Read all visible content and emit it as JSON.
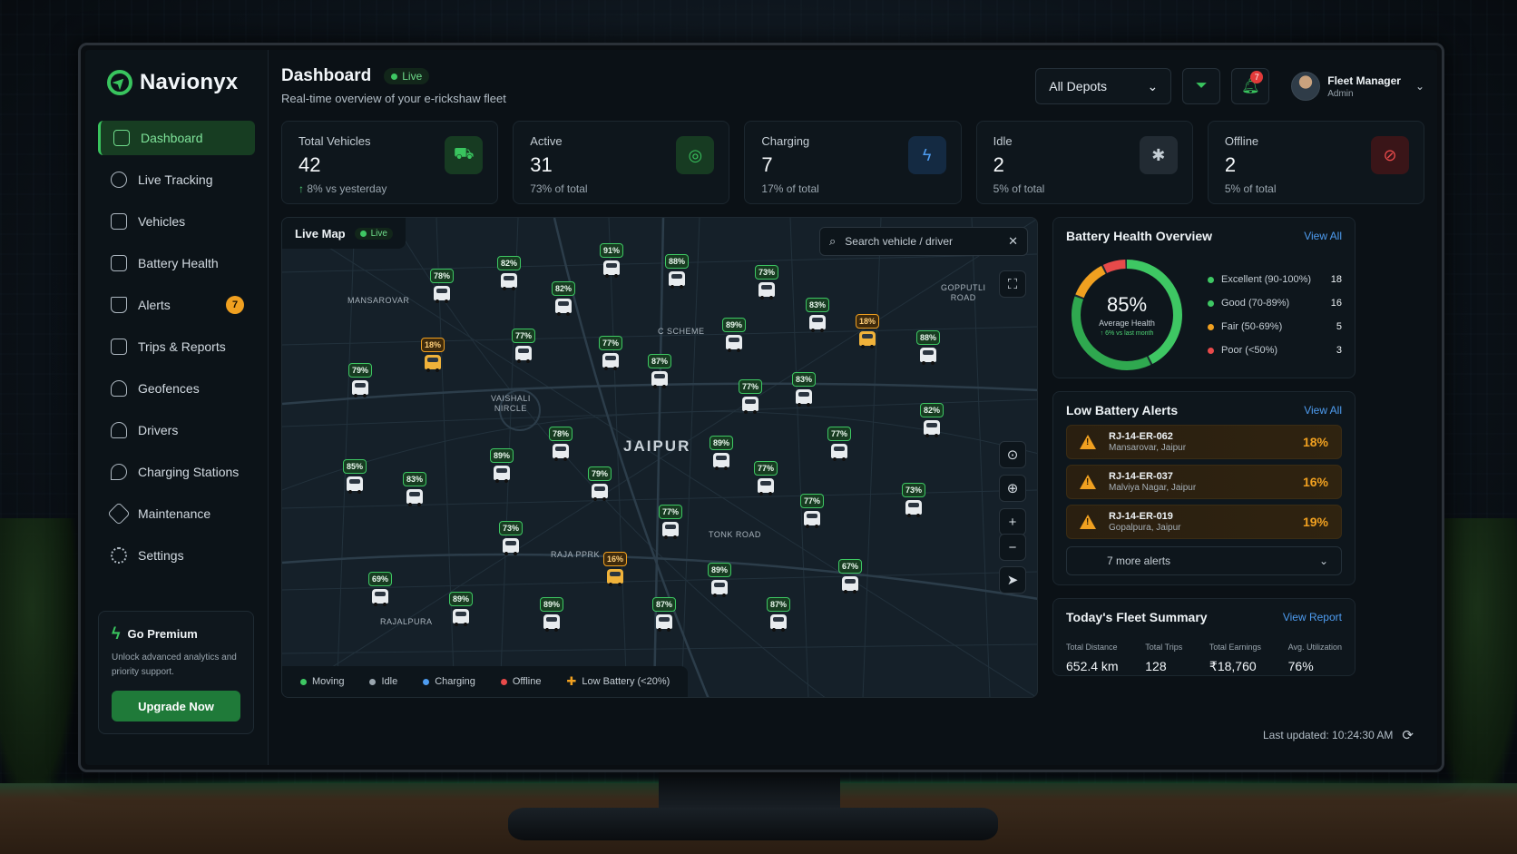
{
  "brand": {
    "name": "Navionyx"
  },
  "sidebar": {
    "items": [
      {
        "label": "Dashboard",
        "icon": "dashboard-icon",
        "active": true
      },
      {
        "label": "Live Tracking",
        "icon": "location-icon"
      },
      {
        "label": "Vehicles",
        "icon": "vehicle-icon"
      },
      {
        "label": "Battery Health",
        "icon": "battery-icon"
      },
      {
        "label": "Alerts",
        "icon": "alert-icon",
        "badge": "7"
      },
      {
        "label": "Trips & Reports",
        "icon": "report-icon"
      },
      {
        "label": "Geofences",
        "icon": "geofence-icon"
      },
      {
        "label": "Drivers",
        "icon": "driver-icon"
      },
      {
        "label": "Charging Stations",
        "icon": "charging-station-icon"
      },
      {
        "label": "Maintenance",
        "icon": "wrench-icon"
      },
      {
        "label": "Settings",
        "icon": "gear-icon"
      }
    ],
    "premium": {
      "title": "Go Premium",
      "text": "Unlock advanced analytics and priority support.",
      "button": "Upgrade Now"
    }
  },
  "header": {
    "title": "Dashboard",
    "live": "Live",
    "subtitle": "Real-time overview of your e-rickshaw fleet",
    "depot": "All Depots",
    "notifications": "7",
    "user_name": "Fleet Manager",
    "user_role": "Admin"
  },
  "stats": [
    {
      "label": "Total Vehicles",
      "value": "42",
      "sub_prefix": "↑",
      "sub": " 8% vs yesterday",
      "color": "#39c45e",
      "bg": "#173b22",
      "icon": "car-icon",
      "glyph": "⛟"
    },
    {
      "label": "Active",
      "value": "31",
      "sub": "73% of total",
      "color": "#39c45e",
      "bg": "#173b22",
      "icon": "steering-icon",
      "glyph": "◎"
    },
    {
      "label": "Charging",
      "value": "7",
      "sub": "17% of total",
      "color": "#4e9cf0",
      "bg": "#142a42",
      "icon": "charging-bolt-icon",
      "glyph": "ϟ"
    },
    {
      "label": "Idle",
      "value": "2",
      "sub": "5% of total",
      "color": "#c4cdd4",
      "bg": "#222b33",
      "icon": "idle-wheel-icon",
      "glyph": "✱"
    },
    {
      "label": "Offline",
      "value": "2",
      "sub": "5% of total",
      "color": "#e84a4a",
      "bg": "#3a1518",
      "icon": "offline-icon",
      "glyph": "⊘"
    }
  ],
  "map": {
    "title": "Live Map",
    "live": "Live",
    "search_placeholder": "Search vehicle / driver",
    "city": "JAIPUR",
    "areas": [
      {
        "text": "MANSAROVAR"
      },
      {
        "text": "C SCHEME"
      },
      {
        "text": "GOPPUTLI\nROAD"
      },
      {
        "text": "VAISHALI\nNIRCLE"
      },
      {
        "text": "TONK ROAD"
      },
      {
        "text": "RAJA PPRK"
      },
      {
        "text": "RAJALPURA"
      }
    ],
    "vehicles": [
      {
        "pct": "78%"
      },
      {
        "pct": "82%"
      },
      {
        "pct": "91%"
      },
      {
        "pct": "88%"
      },
      {
        "pct": "82%"
      },
      {
        "pct": "73%"
      },
      {
        "pct": "83%"
      },
      {
        "pct": "18%",
        "low": true
      },
      {
        "pct": "88%"
      },
      {
        "pct": "18%",
        "low": true
      },
      {
        "pct": "79%"
      },
      {
        "pct": "77%"
      },
      {
        "pct": "77%"
      },
      {
        "pct": "87%"
      },
      {
        "pct": "89%"
      },
      {
        "pct": "77%"
      },
      {
        "pct": "83%"
      },
      {
        "pct": "82%"
      },
      {
        "pct": "85%"
      },
      {
        "pct": "83%"
      },
      {
        "pct": "89%"
      },
      {
        "pct": "78%"
      },
      {
        "pct": "79%"
      },
      {
        "pct": "89%"
      },
      {
        "pct": "77%"
      },
      {
        "pct": "77%"
      },
      {
        "pct": "77%"
      },
      {
        "pct": "73%"
      },
      {
        "pct": "73%"
      },
      {
        "pct": "77%"
      },
      {
        "pct": "16%",
        "low": true
      },
      {
        "pct": "89%"
      },
      {
        "pct": "67%"
      },
      {
        "pct": "69%"
      },
      {
        "pct": "89%"
      },
      {
        "pct": "89%"
      },
      {
        "pct": "87%"
      },
      {
        "pct": "87%"
      }
    ],
    "legend": [
      {
        "label": "Moving",
        "color": "#3ec763"
      },
      {
        "label": "Idle",
        "color": "#9aa6af"
      },
      {
        "label": "Charging",
        "color": "#4e9cf0"
      },
      {
        "label": "Offline",
        "color": "#e84a4a"
      },
      {
        "label": "Low Battery (<20%)",
        "color": "#f0a020",
        "plus": true
      }
    ]
  },
  "battery": {
    "title": "Battery Health Overview",
    "link": "View All",
    "value": "85%",
    "label": "Average Health",
    "sub": "↑ 6% vs last month",
    "rows": [
      {
        "name": "Excellent (90-100%)",
        "count": "18",
        "color": "#3ec763",
        "n": 18
      },
      {
        "name": "Good (70-89%)",
        "count": "16",
        "color": "#3ec763",
        "n": 16
      },
      {
        "name": "Fair (50-69%)",
        "count": "5",
        "color": "#f0a020",
        "n": 5
      },
      {
        "name": "Poor (<50%)",
        "count": "3",
        "color": "#e84a4a",
        "n": 3
      }
    ]
  },
  "low_battery": {
    "title": "Low Battery Alerts",
    "link": "View All",
    "alerts": [
      {
        "id": "RJ-14-ER-062",
        "loc": "Mansarovar, Jaipur",
        "pct": "18%"
      },
      {
        "id": "RJ-14-ER-037",
        "loc": "Malviya Nagar, Jaipur",
        "pct": "16%"
      },
      {
        "id": "RJ-14-ER-019",
        "loc": "Gopalpura, Jaipur",
        "pct": "19%"
      }
    ],
    "more": "7 more alerts"
  },
  "summary": {
    "title": "Today's Fleet Summary",
    "link": "View Report",
    "items": [
      {
        "label": "Total Distance",
        "value": "652.4 km"
      },
      {
        "label": "Total Trips",
        "value": "128"
      },
      {
        "label": "Total Earnings",
        "value": "₹18,760"
      },
      {
        "label": "Avg. Utilization",
        "value": "76%"
      }
    ]
  },
  "last_updated": "Last updated: 10:24:30 AM"
}
